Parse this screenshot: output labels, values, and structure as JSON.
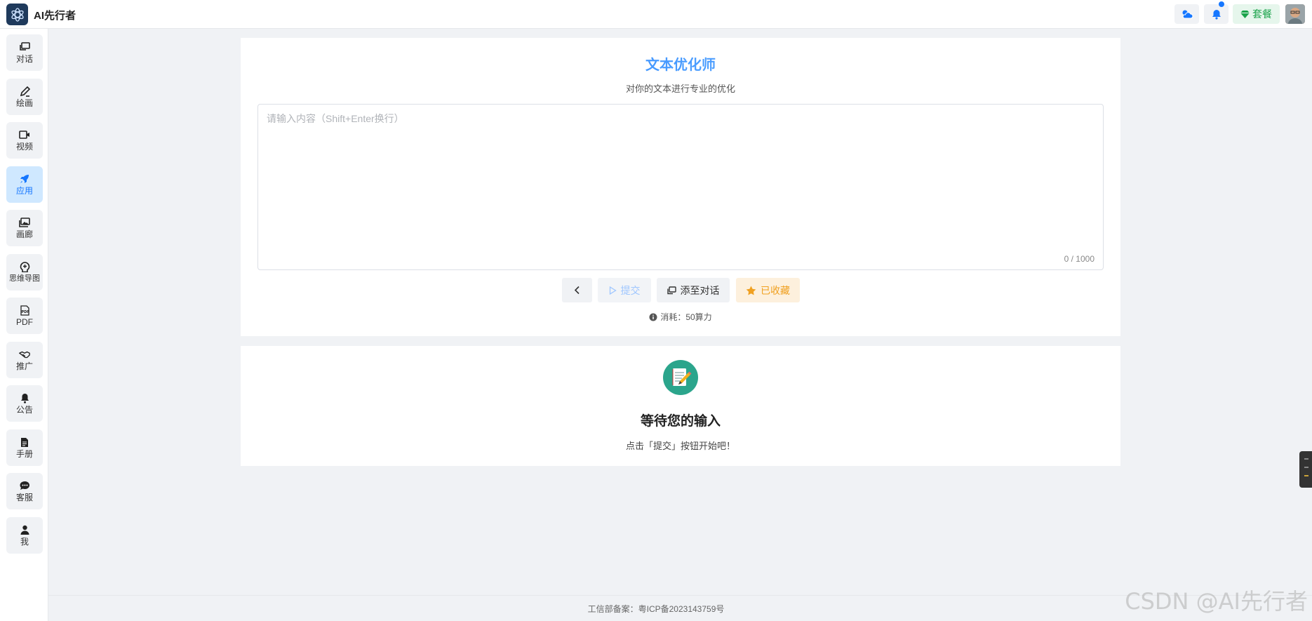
{
  "header": {
    "app_name": "AI先行者",
    "plan_label": "套餐"
  },
  "sidebar": {
    "items": [
      {
        "label": "对话"
      },
      {
        "label": "绘画"
      },
      {
        "label": "视频"
      },
      {
        "label": "应用"
      },
      {
        "label": "画廊"
      },
      {
        "label": "思维导图"
      },
      {
        "label": "PDF"
      },
      {
        "label": "推广"
      },
      {
        "label": "公告"
      },
      {
        "label": "手册"
      },
      {
        "label": "客服"
      },
      {
        "label": "我"
      }
    ]
  },
  "main": {
    "title": "文本优化师",
    "subtitle": "对你的文本进行专业的优化",
    "input_placeholder": "请输入内容（Shift+Enter换行）",
    "counter": "0 / 1000",
    "submit_label": "提交",
    "add_label": "添至对话",
    "fav_label": "已收藏",
    "cost_text": "消耗：50算力"
  },
  "result": {
    "title": "等待您的输入",
    "subtitle": "点击「提交」按钮开始吧！"
  },
  "footer": {
    "text": "工信部备案：粤ICP备2023143759号"
  },
  "watermark": "CSDN @AI先行者",
  "colors": {
    "accent": "#1677ff",
    "favorite": "#f0a020",
    "plan": "#1aa34a"
  }
}
